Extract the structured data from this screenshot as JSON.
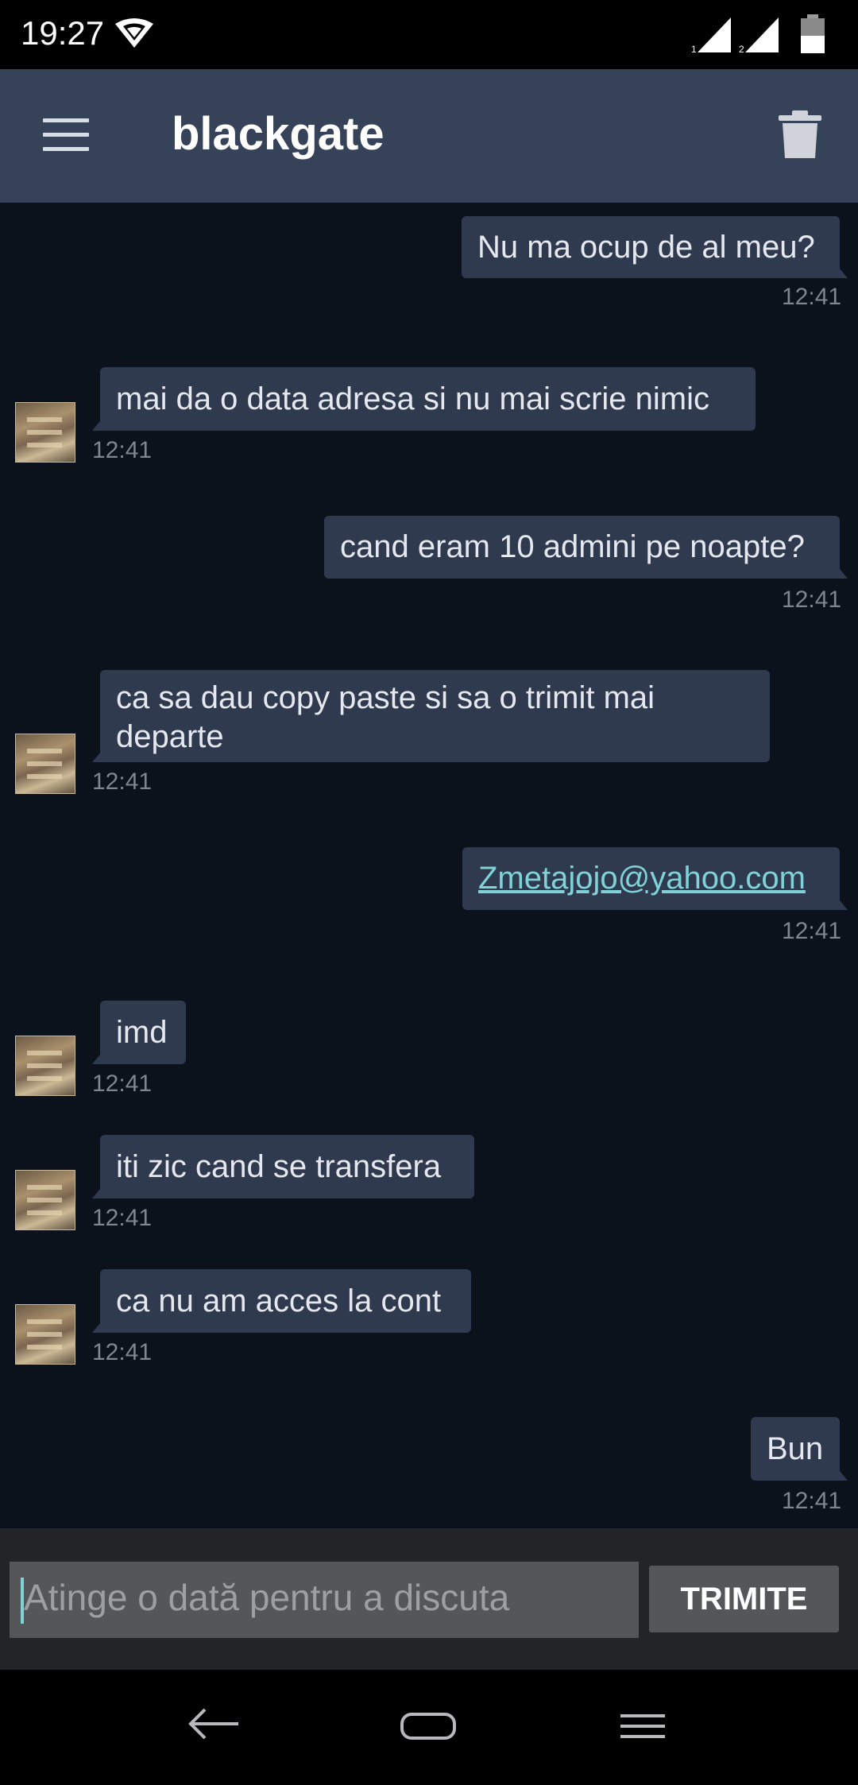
{
  "status_bar": {
    "time": "19:27",
    "sim1": "1",
    "sim2": "2"
  },
  "app_bar": {
    "title": "blackgate",
    "menu_icon": "hamburger-icon",
    "delete_icon": "trash-icon"
  },
  "messages": [
    {
      "direction": "out",
      "text": "Nu ma ocup de al meu?",
      "time": "12:41"
    },
    {
      "direction": "in",
      "text": "mai da o data adresa si nu mai scrie nimic",
      "time": "12:41"
    },
    {
      "direction": "out",
      "text": "cand eram 10 admini pe noapte?",
      "time": "12:41"
    },
    {
      "direction": "in",
      "text": "ca sa dau copy paste si sa o trimit mai departe",
      "time": "12:41"
    },
    {
      "direction": "out",
      "text": "Zmetajojo@yahoo.com",
      "time": "12:41",
      "is_link": true
    },
    {
      "direction": "in",
      "text": "imd",
      "time": "12:41"
    },
    {
      "direction": "in",
      "text": "iti zic cand se transfera",
      "time": "12:41"
    },
    {
      "direction": "in",
      "text": "ca nu am acces la cont",
      "time": "12:41"
    },
    {
      "direction": "out",
      "text": "Bun",
      "time": "12:41"
    }
  ],
  "composer": {
    "placeholder": "Atinge o dată pentru a discuta",
    "send_label": "TRIMITE"
  },
  "colors": {
    "app_bar": "#354257",
    "background": "#0b121c",
    "bubble": "#2f3a4f",
    "link": "#7fd3d6"
  }
}
